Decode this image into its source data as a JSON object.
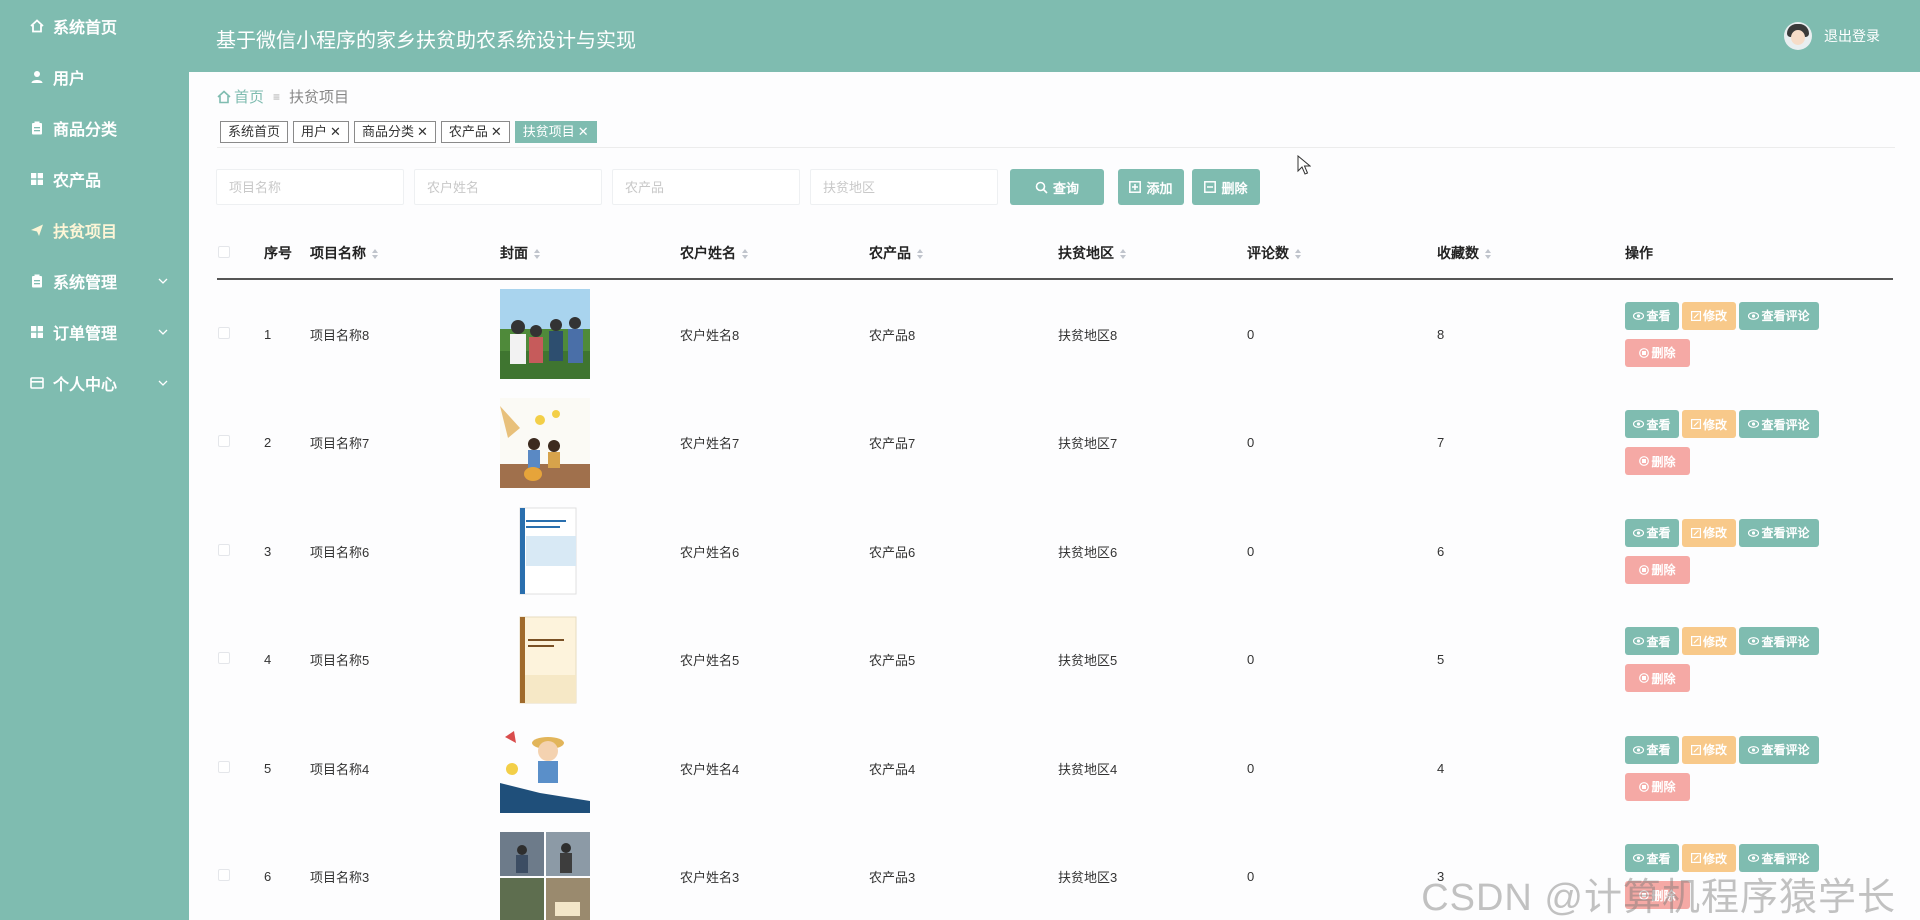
{
  "header": {
    "title": "基于微信小程序的家乡扶贫助农系统设计与实现",
    "logout_label": "退出登录"
  },
  "sidebar": {
    "items": [
      {
        "label": "系统首页",
        "icon": "home-icon"
      },
      {
        "label": "用户",
        "icon": "user-icon"
      },
      {
        "label": "商品分类",
        "icon": "clipboard-icon"
      },
      {
        "label": "农产品",
        "icon": "grid-icon"
      },
      {
        "label": "扶贫项目",
        "icon": "paper-plane-icon"
      },
      {
        "label": "系统管理",
        "icon": "clipboard-icon"
      },
      {
        "label": "订单管理",
        "icon": "grid-icon"
      },
      {
        "label": "个人中心",
        "icon": "id-card-icon"
      }
    ]
  },
  "breadcrumb": {
    "home": "首页",
    "separator": "≡",
    "current": "扶贫项目"
  },
  "tags": [
    {
      "label": "系统首页"
    },
    {
      "label": "用户"
    },
    {
      "label": "商品分类"
    },
    {
      "label": "农产品"
    },
    {
      "label": "扶贫项目"
    }
  ],
  "search": {
    "project_name_placeholder": "项目名称",
    "farmer_name_placeholder": "农户姓名",
    "product_placeholder": "农产品",
    "area_placeholder": "扶贫地区",
    "query_label": "查询",
    "add_label": "添加",
    "delete_label": "删除"
  },
  "table": {
    "headers": {
      "index": "序号",
      "name": "项目名称",
      "cover": "封面",
      "farmer": "农户姓名",
      "product": "农产品",
      "area": "扶贫地区",
      "comments": "评论数",
      "favorites": "收藏数",
      "operations": "操作"
    },
    "actions": {
      "view": "查看",
      "edit": "修改",
      "view_comments": "查看评论",
      "delete": "删除"
    },
    "rows": [
      {
        "index": "1",
        "name": "项目名称8",
        "farmer": "农户姓名8",
        "product": "农产品8",
        "area": "扶贫地区8",
        "comments": "0",
        "favorites": "8"
      },
      {
        "index": "2",
        "name": "项目名称7",
        "farmer": "农户姓名7",
        "product": "农产品7",
        "area": "扶贫地区7",
        "comments": "0",
        "favorites": "7"
      },
      {
        "index": "3",
        "name": "项目名称6",
        "farmer": "农户姓名6",
        "product": "农产品6",
        "area": "扶贫地区6",
        "comments": "0",
        "favorites": "6"
      },
      {
        "index": "4",
        "name": "项目名称5",
        "farmer": "农户姓名5",
        "product": "农产品5",
        "area": "扶贫地区5",
        "comments": "0",
        "favorites": "5"
      },
      {
        "index": "5",
        "name": "项目名称4",
        "farmer": "农户姓名4",
        "product": "农产品4",
        "area": "扶贫地区4",
        "comments": "0",
        "favorites": "4"
      },
      {
        "index": "6",
        "name": "项目名称3",
        "farmer": "农户姓名3",
        "product": "农产品3",
        "area": "扶贫地区3",
        "comments": "0",
        "favorites": "3"
      }
    ]
  },
  "watermark": "CSDN @计算机程序猿学长",
  "colors": {
    "primary": "#7fbcb0",
    "edit": "#f8c98a",
    "danger": "#f5a9a5"
  }
}
